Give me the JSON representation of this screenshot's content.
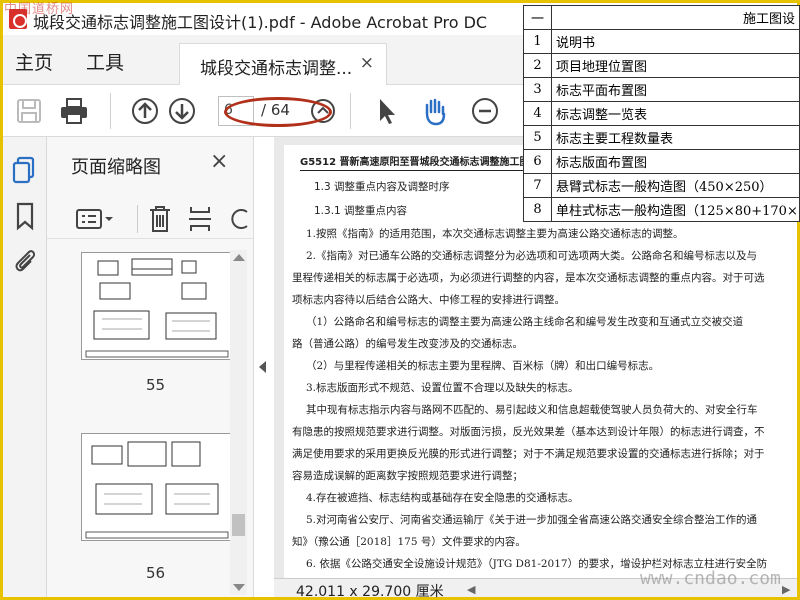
{
  "window": {
    "title": "城段交通标志调整施工图设计(1).pdf - Adobe Acrobat Pro DC",
    "watermark_top": "中国道桥网"
  },
  "menu": {
    "home": "主页",
    "tools": "工具"
  },
  "tab": {
    "label": "城段交通标志调整...",
    "close": "×"
  },
  "toolbar": {
    "current_page": "6",
    "total_pages": "/ 64",
    "icons": [
      "save-icon",
      "print-icon",
      "page-up-icon",
      "page-down-icon",
      "page-input",
      "zoom-icon",
      "select-arrow-icon",
      "hand-tool-icon",
      "zoom-out-icon"
    ]
  },
  "rail": {
    "icons": [
      "pages-icon",
      "bookmark-icon",
      "attachment-icon"
    ]
  },
  "thumbnails": {
    "title": "页面缩略图",
    "close": "×",
    "pages": [
      {
        "label": "55"
      },
      {
        "label": "56"
      }
    ]
  },
  "document": {
    "header": "G5512 晋新高速原阳至晋城段交通标志调整施工图",
    "h1": "1.3 调整重点内容及调整时序",
    "h2": "1.3.1 调整重点内容",
    "paragraphs": [
      "1.按照《指南》的适用范围，本次交通标志调整主要为高速公路交通标志的调整。",
      "2.《指南》对已通车公路的交通标志调整分为必选项和可选项两大类。公路命名和编号标志以及与",
      "里程传递相关的标志属于必选项，为必须进行调整的内容，是本次交通标志调整的重点内容。对于可选",
      "项标志内容待以后结合公路大、中修工程的安排进行调整。",
      "（1）公路命名和编号标志的调整主要为高速公路主线命名和编号发生改变和互通式立交被交道",
      "路（普通公路）的编号发生改变涉及的交通标志。",
      "（2）与里程传递相关的标志主要为里程牌、百米标（牌）和出口编号标志。",
      "3.标志版面形式不规范、设置位置不合理以及缺失的标志。",
      "其中现有标志指示内容与路网不匹配的、易引起歧义和信息超载使驾驶人员负荷大的、对安全行车",
      "有隐患的按照规范要求进行调整。对版面污损，反光效果差（基本达到设计年限）的标志进行调查，不",
      "满足使用要求的采用更换反光膜的形式进行调整；对于不满足规范要求设置的交通标志进行拆除；对于",
      "容易造成误解的距离数字按照规范要求进行调整；",
      "4.存在被遮挡、标志结构或基础存在安全隐患的交通标志。",
      "5.对河南省公安厅、河南省交通运输厅《关于进一步加强全省高速公路交通安全综合整治工作的通",
      "知》（豫公通［2018］175 号）文件要求的内容。",
      "6. 依据《公路交通安全设施设计规范》（JTG D81-2017）的要求，增设护栏对标志立柱进行安全防"
    ]
  },
  "statusbar": {
    "size": "42.011 x 29.700 厘米"
  },
  "overlay_table": {
    "header_col1": "一",
    "header_col2": "施工图设",
    "rows": [
      {
        "n": "1",
        "t": "说明书"
      },
      {
        "n": "2",
        "t": "项目地理位置图"
      },
      {
        "n": "3",
        "t": "标志平面布置图"
      },
      {
        "n": "4",
        "t": "标志调整一览表"
      },
      {
        "n": "5",
        "t": "标志主要工程数量表"
      },
      {
        "n": "6",
        "t": "标志版面布置图"
      },
      {
        "n": "7",
        "t": "悬臂式标志一般构造图（450×250）"
      },
      {
        "n": "8",
        "t": "单柱式标志一般构造图（125×80+170×"
      }
    ]
  },
  "watermark_bottom": "www.cndao.com",
  "colors": {
    "accent_blue": "#2b6fc4",
    "frame_yellow": "#e7c200",
    "ellipse_red": "#b0301a"
  }
}
